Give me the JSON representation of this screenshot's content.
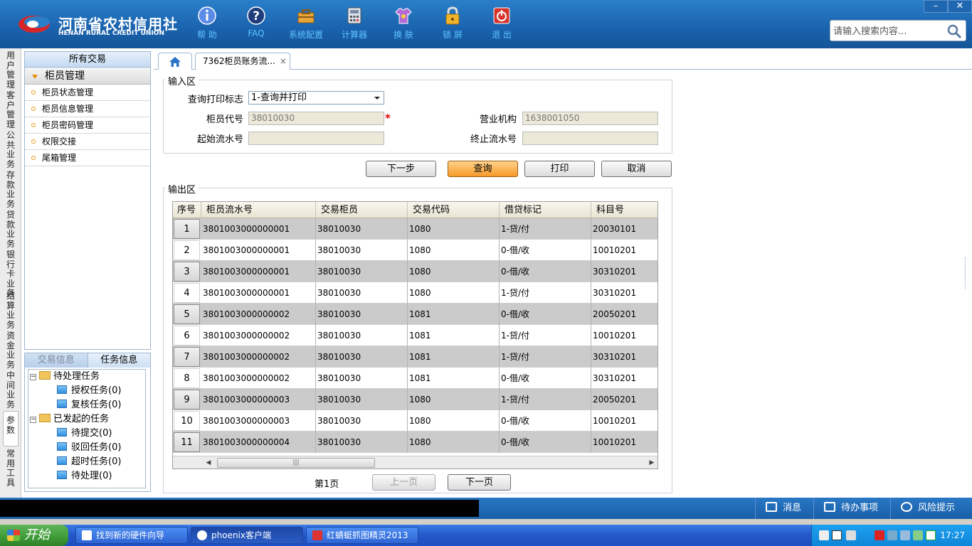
{
  "app": {
    "logo_cn": "河南省农村信用社",
    "logo_en": "HENAN RURAL CREDIT UNION",
    "toolbar": [
      {
        "label": "帮 助",
        "icon": "info-icon"
      },
      {
        "label": "FAQ",
        "icon": "faq-icon"
      },
      {
        "label": "系统配置",
        "icon": "toolbox-icon"
      },
      {
        "label": "计算器",
        "icon": "calculator-icon"
      },
      {
        "label": "换 肤",
        "icon": "shirt-icon"
      },
      {
        "label": "锁 屏",
        "icon": "lock-icon"
      },
      {
        "label": "退 出",
        "icon": "power-icon"
      }
    ],
    "window_controls": {
      "minimize": "–",
      "close": "✕"
    },
    "search": {
      "placeholder": "请输入搜索内容...",
      "value": ""
    }
  },
  "vtabs": [
    "用户管理",
    "客户管理",
    "公共业务",
    "存款业务",
    "贷款业务",
    "银行卡业务",
    "结算业务",
    "资金业务",
    "中间业务",
    "参数",
    "常用工具"
  ],
  "menu": {
    "header": "所有交易",
    "group": "柜员管理",
    "items": [
      "柜员状态管理",
      "柜员信息管理",
      "柜员密码管理",
      "权限交接",
      "尾箱管理"
    ]
  },
  "task_panel": {
    "tabs": [
      "交易信息",
      "任务信息"
    ],
    "tree": [
      {
        "label": "待处理任务",
        "children": [
          "授权任务(0)",
          "复核任务(0)"
        ]
      },
      {
        "label": "已发起的任务",
        "children": [
          "待提交(0)",
          "驳回任务(0)",
          "超时任务(0)",
          "待处理(0)"
        ]
      }
    ]
  },
  "tabs": {
    "active": "7362柜员账务流...",
    "close": "×"
  },
  "input_area": {
    "title": "输入区",
    "query_flag_label": "查询打印标志",
    "query_flag_value": "1-查询并打印",
    "teller_label": "柜员代号",
    "teller_value": "38010030",
    "org_label": "营业机构",
    "org_value": "1638001050",
    "start_label": "起始流水号",
    "start_value": "",
    "end_label": "终止流水号",
    "end_value": "",
    "required_mark": "*"
  },
  "buttons": {
    "next": "下一步",
    "query": "查询",
    "print": "打印",
    "cancel": "取消"
  },
  "output_area": {
    "title": "输出区",
    "columns": [
      "序号",
      "柜员流水号",
      "交易柜员",
      "交易代码",
      "借贷标记",
      "科目号"
    ],
    "rows": [
      [
        "1",
        "3801003000000001",
        "38010030",
        "1080",
        "1-贷/付",
        "20030101"
      ],
      [
        "2",
        "3801003000000001",
        "38010030",
        "1080",
        "0-借/收",
        "10010201"
      ],
      [
        "3",
        "3801003000000001",
        "38010030",
        "1080",
        "0-借/收",
        "30310201"
      ],
      [
        "4",
        "3801003000000001",
        "38010030",
        "1080",
        "1-贷/付",
        "30310201"
      ],
      [
        "5",
        "3801003000000002",
        "38010030",
        "1081",
        "0-借/收",
        "20050201"
      ],
      [
        "6",
        "3801003000000002",
        "38010030",
        "1081",
        "1-贷/付",
        "10010201"
      ],
      [
        "7",
        "3801003000000002",
        "38010030",
        "1081",
        "1-贷/付",
        "30310201"
      ],
      [
        "8",
        "3801003000000002",
        "38010030",
        "1081",
        "0-借/收",
        "30310201"
      ],
      [
        "9",
        "3801003000000003",
        "38010030",
        "1080",
        "1-贷/付",
        "20050201"
      ],
      [
        "10",
        "3801003000000003",
        "38010030",
        "1080",
        "0-借/收",
        "10010201"
      ],
      [
        "11",
        "3801003000000004",
        "38010030",
        "1080",
        "0-借/收",
        "10010201"
      ]
    ],
    "scroll_thumb": "|||"
  },
  "pager": {
    "page_label": "第1页",
    "prev": "上一页",
    "next": "下一页"
  },
  "status_bar": {
    "messages": "消息",
    "todo": "待办事项",
    "risk": "风险提示"
  },
  "taskbar": {
    "start": "开始",
    "items": [
      "找到新的硬件向导",
      "phoenix客户端",
      "红蜻蜓抓图精灵2013"
    ],
    "clock": "17:27"
  }
}
